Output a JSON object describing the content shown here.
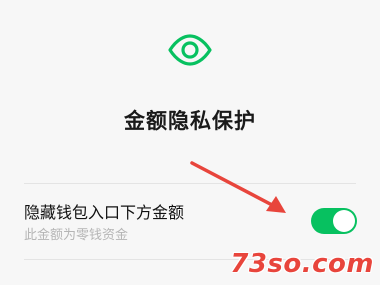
{
  "header": {
    "icon": "eye-icon",
    "title": "金额隐私保护"
  },
  "settings": {
    "hide_wallet_entry": {
      "label": "隐藏钱包入口下方金额",
      "description": "此金额为零钱资金",
      "enabled": true
    }
  },
  "annotation": {
    "type": "red-arrow-pointing-to-toggle"
  },
  "watermark": {
    "text": "73so.com"
  },
  "colors": {
    "accent": "#07c160",
    "arrow": "#e8453c",
    "background": "#f7f7f7"
  }
}
